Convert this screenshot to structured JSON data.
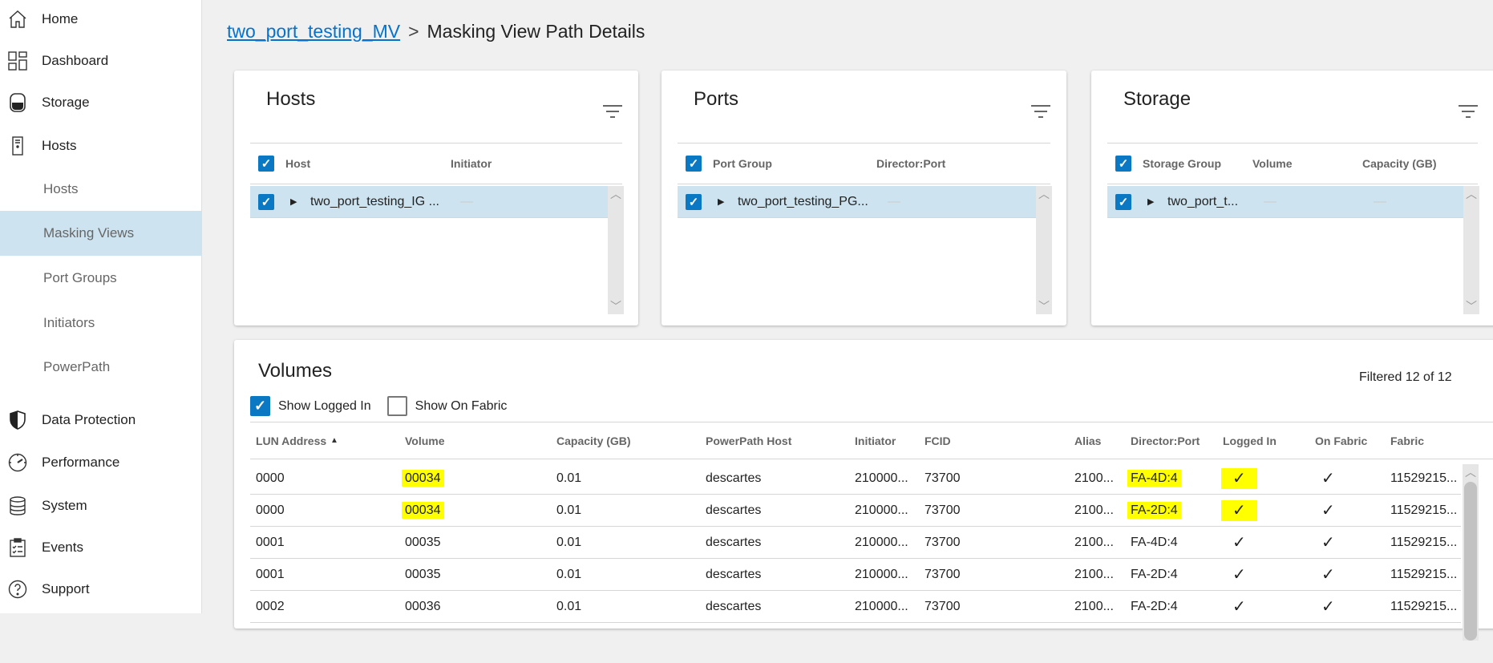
{
  "sidebar": {
    "items": [
      {
        "label": "Home",
        "icon": "home-icon"
      },
      {
        "label": "Dashboard",
        "icon": "dashboard-icon"
      },
      {
        "label": "Storage",
        "icon": "storage-icon"
      },
      {
        "label": "Hosts",
        "icon": "hosts-icon"
      },
      {
        "label": "Hosts",
        "sub": true
      },
      {
        "label": "Masking Views",
        "sub": true,
        "active": true
      },
      {
        "label": "Port Groups",
        "sub": true
      },
      {
        "label": "Initiators",
        "sub": true
      },
      {
        "label": "PowerPath",
        "sub": true
      },
      {
        "label": "Data Protection",
        "icon": "shield-icon"
      },
      {
        "label": "Performance",
        "icon": "gauge-icon"
      },
      {
        "label": "System",
        "icon": "database-icon"
      },
      {
        "label": "Events",
        "icon": "clipboard-icon"
      },
      {
        "label": "Support",
        "icon": "help-icon"
      }
    ]
  },
  "breadcrumb": {
    "parent": "two_port_testing_MV",
    "separator": ">",
    "current": "Masking View Path Details"
  },
  "hosts": {
    "title": "Hosts",
    "cols": [
      "Host",
      "Initiator"
    ],
    "row": {
      "name": "two_port_testing_IG ...",
      "initiator": "—"
    }
  },
  "ports": {
    "title": "Ports",
    "cols": [
      "Port Group",
      "Director:Port"
    ],
    "row": {
      "name": "two_port_testing_PG...",
      "port": "—"
    }
  },
  "storage": {
    "title": "Storage",
    "cols": [
      "Storage Group",
      "Volume",
      "Capacity (GB)"
    ],
    "row": {
      "name": "two_port_t...",
      "volume": "—",
      "capacity": "—"
    }
  },
  "volumes": {
    "title": "Volumes",
    "filtered": "Filtered 12 of 12",
    "show_logged_in": "Show Logged In",
    "show_on_fabric": "Show On Fabric",
    "cols": [
      "LUN Address",
      "Volume",
      "Capacity (GB)",
      "PowerPath Host",
      "Initiator",
      "FCID",
      "Alias",
      "Director:Port",
      "Logged In",
      "On Fabric",
      "Fabric"
    ],
    "sort_indicator": "▲",
    "rows": [
      {
        "lun": "0000",
        "volume": "00034",
        "cap": "0.01",
        "pp": "descartes",
        "init": "210000...",
        "fcid": "73700",
        "alias": "2100...",
        "dp": "FA-4D:4",
        "logged": "✓",
        "fabric_ok": "✓",
        "fabric": "11529215...",
        "highlight": true
      },
      {
        "lun": "0000",
        "volume": "00034",
        "cap": "0.01",
        "pp": "descartes",
        "init": "210000...",
        "fcid": "73700",
        "alias": "2100...",
        "dp": "FA-2D:4",
        "logged": "✓",
        "fabric_ok": "✓",
        "fabric": "11529215...",
        "highlight": true
      },
      {
        "lun": "0001",
        "volume": "00035",
        "cap": "0.01",
        "pp": "descartes",
        "init": "210000...",
        "fcid": "73700",
        "alias": "2100...",
        "dp": "FA-4D:4",
        "logged": "✓",
        "fabric_ok": "✓",
        "fabric": "11529215..."
      },
      {
        "lun": "0001",
        "volume": "00035",
        "cap": "0.01",
        "pp": "descartes",
        "init": "210000...",
        "fcid": "73700",
        "alias": "2100...",
        "dp": "FA-2D:4",
        "logged": "✓",
        "fabric_ok": "✓",
        "fabric": "11529215..."
      },
      {
        "lun": "0002",
        "volume": "00036",
        "cap": "0.01",
        "pp": "descartes",
        "init": "210000...",
        "fcid": "73700",
        "alias": "2100...",
        "dp": "FA-2D:4",
        "logged": "✓",
        "fabric_ok": "✓",
        "fabric": "11529215..."
      }
    ]
  }
}
